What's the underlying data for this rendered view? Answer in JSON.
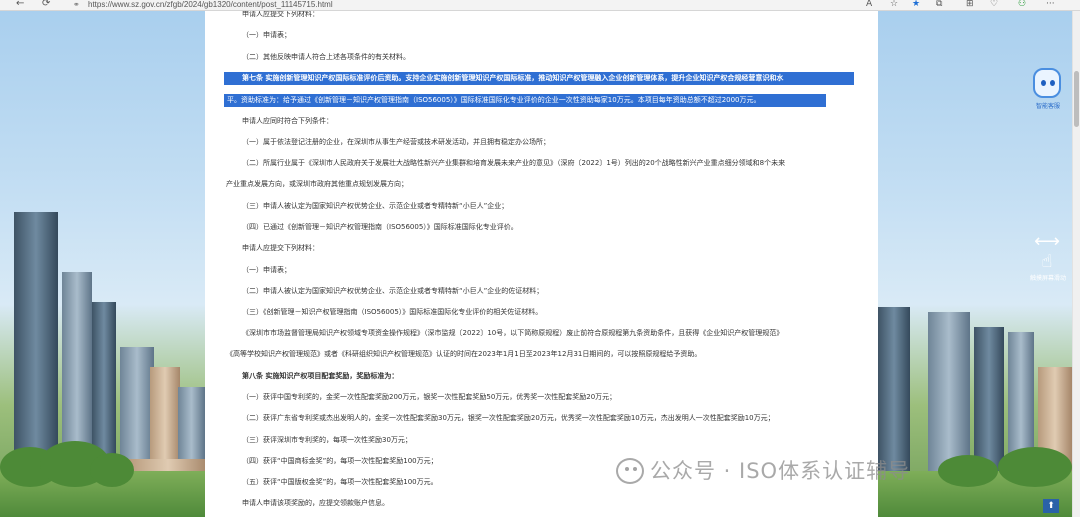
{
  "browser": {
    "url": "https://www.sz.gov.cn/zfgb/2024/gb1320/content/post_11145715.html",
    "back_glyph": "←",
    "refresh_glyph": "⟳",
    "lock_glyph": "🔒",
    "toolbar_glyphs": [
      "A",
      "☆",
      "★",
      "⧉",
      "⊞",
      "♡",
      "⚇",
      "···"
    ]
  },
  "article": {
    "lines": [
      "申请人应提交下列材料：",
      "（一）申请表；",
      "（二）其他反映申请人符合上述各项条件的有关材料。",
      "第七条  实施创新管理知识产权国际标准评价后资助。支持企业实施创新管理知识产权国际标准，推动知识产权管理融入企业创新管理体系，提升企业知识产权合规经营意识和水",
      "平。资助标准为：给予通过《创新管理－知识产权管理指南（ISO56005）》国际标准国际化专业评价的企业一次性资助每家10万元。本项目每年资助总额不超过2000万元。",
      "申请人应同时符合下列条件：",
      "（一）属于依法登记注册的企业，在深圳市从事生产经营或技术研发活动，并且拥有稳定办公场所；",
      "（二）所属行业属于《深圳市人民政府关于发展壮大战略性新兴产业集群和培育发展未来产业的意见》（深府〔2022〕1号）列出的20个战略性新兴产业重点细分领域和8个未来",
      "产业重点发展方向，或深圳市政府其他重点规划发展方向；",
      "（三）申请人被认定为国家知识产权优势企业、示范企业或者专精特新“小巨人”企业；",
      "（四）已通过《创新管理－知识产权管理指南（ISO56005）》国际标准国际化专业评价。",
      "申请人应提交下列材料：",
      "（一）申请表；",
      "（二）申请人被认定为国家知识产权优势企业、示范企业或者专精特新“小巨人”企业的佐证材料；",
      "（三）《创新管理－知识产权管理指南（ISO56005）》国际标准国际化专业评价的相关佐证材料。",
      "《深圳市市场监督管理局知识产权领域专项资金操作规程》（深市监规〔2022〕10号，以下简称原规程）废止前符合原规程第九条资助条件，且获得《企业知识产权管理规范》",
      "《高等学校知识产权管理规范》或者《科研组织知识产权管理规范》认证的时间在2023年1月1日至2023年12月31日期间的，可以按照原规程给予资助。",
      "第八条  实施知识产权项目配套奖励，奖励标准为：",
      "（一）获评中国专利奖的，金奖一次性配套奖励200万元，银奖一次性配套奖励50万元，优秀奖一次性配套奖励20万元；",
      "（二）获评广东省专利奖或杰出发明人的，金奖一次性配套奖励30万元，银奖一次性配套奖励20万元，优秀奖一次性配套奖励10万元，杰出发明人一次性配套奖励10万元；",
      "（三）获评深圳市专利奖的，每项一次性奖励30万元；",
      "（四）获评“中国商标金奖”的，每项一次性配套奖励100万元；",
      "（五）获评“中国版权金奖”的，每项一次性配套奖励100万元。",
      "申请人申请该项奖励的，应提交领款账户信息。"
    ]
  },
  "widgets": {
    "robot_label": "智能客服",
    "hand_glyph": "☝",
    "hand_arrows": "⟷",
    "hand_label": "触摸屏幕滑动",
    "back_to_top": "⬆"
  },
  "watermark": {
    "text": "公众号 · ISO体系认证辅导"
  },
  "colors": {
    "selection": "#2f6fd3",
    "text": "#333333"
  }
}
